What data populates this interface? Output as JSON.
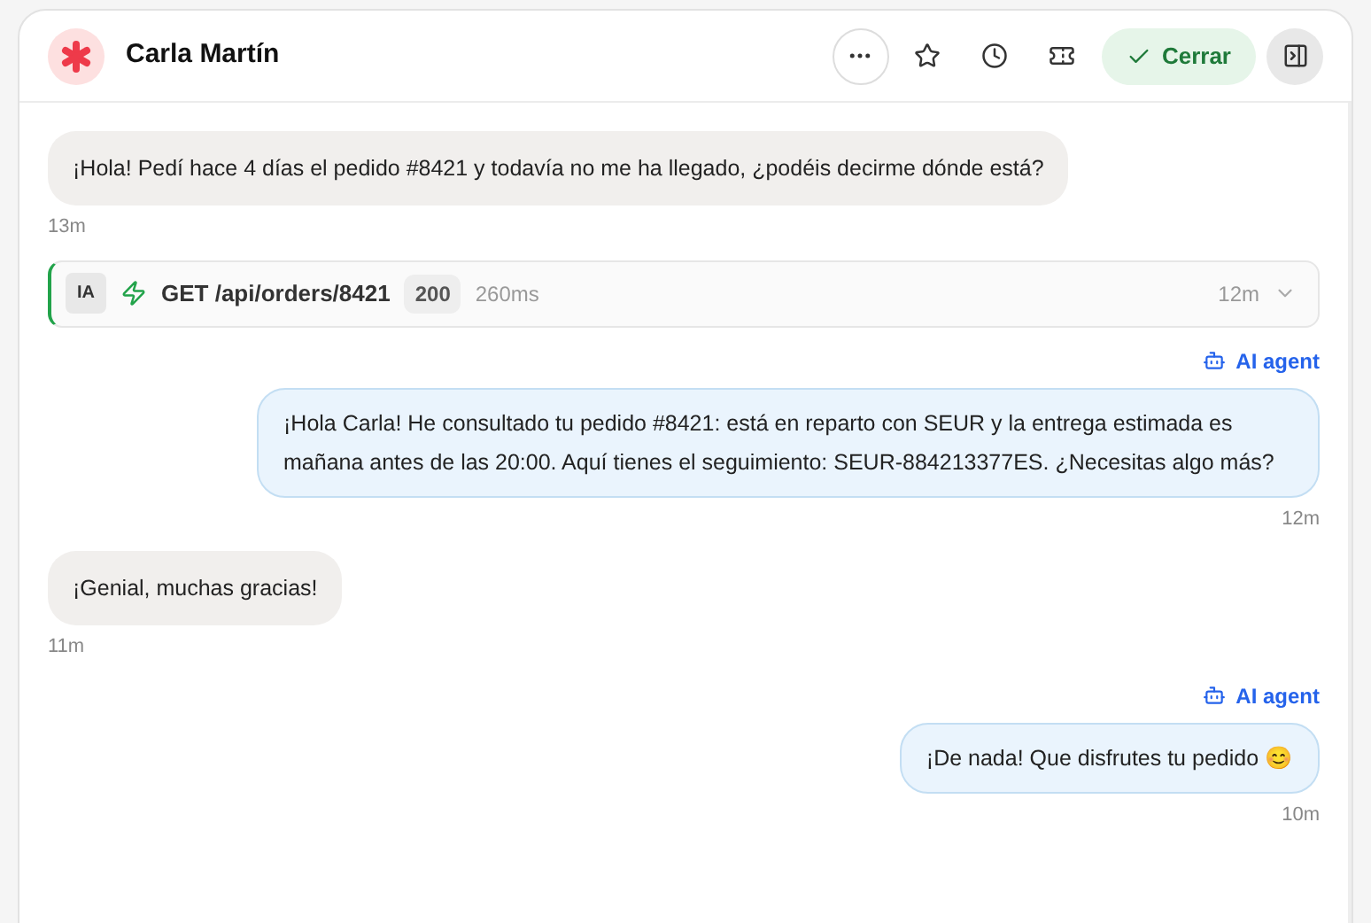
{
  "header": {
    "name": "Carla Martín",
    "close_button": "Cerrar"
  },
  "messages": [
    {
      "kind": "customer",
      "text": "¡Hola! Pedí hace 4 días el pedido #8421 y todavía no me ha llegado, ¿podéis decirme dónde está?",
      "time": "13m"
    },
    {
      "kind": "tool",
      "badge": "IA",
      "request": "GET /api/orders/8421",
      "status": "200",
      "duration": "260ms",
      "time": "12m",
      "expanded": false
    },
    {
      "kind": "agent",
      "author": "AI agent",
      "text": "¡Hola Carla! He consultado tu pedido #8421: está en reparto con SEUR y la entrega estimada es mañana antes de las 20:00. Aquí tienes el seguimiento: SEUR-884213377ES. ¿Necesitas algo más?",
      "time": "12m"
    },
    {
      "kind": "customer",
      "text": "¡Genial, muchas gracias!",
      "time": "11m"
    },
    {
      "kind": "agent",
      "author": "AI agent",
      "text": "¡De nada! Que disfrutes tu pedido 😊",
      "time": "10m"
    }
  ]
}
